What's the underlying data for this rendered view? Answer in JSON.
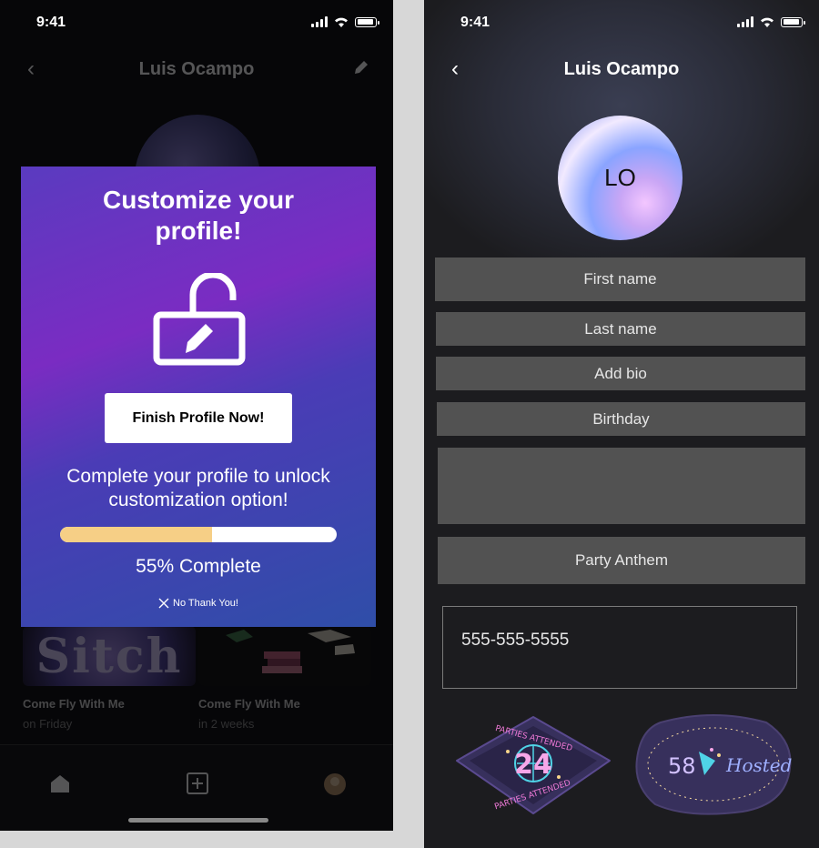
{
  "status_bar": {
    "time": "9:41"
  },
  "left": {
    "nav_title": "Luis Ocampo",
    "modal": {
      "title": "Customize your profile!",
      "cta_label": "Finish Profile Now!",
      "description": "Complete your profile to unlock customization option!",
      "progress": 0.55,
      "progress_label": "55% Complete",
      "dismiss_label": "No Thank You!"
    },
    "events": [
      {
        "title": "Come Fly With Me",
        "subtitle": "on Friday",
        "thumb_text": "Sitch"
      },
      {
        "title": "Come Fly With Me",
        "subtitle": "in 2 weeks"
      }
    ]
  },
  "right": {
    "nav_title": "Luis Ocampo",
    "avatar_initials": "LO",
    "fields": {
      "first_name": "First name",
      "last_name": "Last name",
      "bio": "Add bio",
      "birthday": "Birthday",
      "party_anthem": "Party Anthem"
    },
    "phone": "555-555-5555",
    "badges": {
      "parties_attended": {
        "count": "24",
        "arc_top": "PARTIES ATTENDED",
        "arc_bottom": "PARTIES ATTENDED"
      },
      "hosted": {
        "count": "58",
        "label": "Hosted"
      }
    }
  },
  "colors": {
    "modal_gradient": [
      "#5a3bc0",
      "#7a2cc2",
      "#2f4ea8"
    ],
    "progress_fill": "#f6cf86",
    "field_bg": "#525252"
  }
}
